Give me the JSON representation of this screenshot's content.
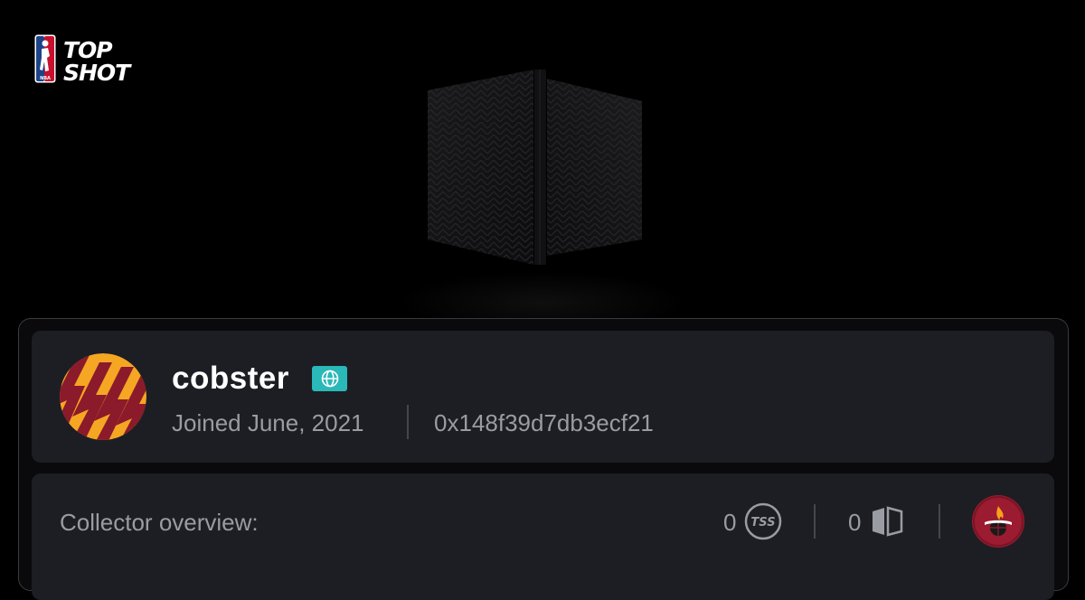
{
  "brand": {
    "logo_line1": "TOP",
    "logo_line2": "SHOT",
    "badge_text": "NBA"
  },
  "profile": {
    "username": "cobster",
    "joined": "Joined June, 2021",
    "address": "0x148f39d7db3ecf21",
    "badge_icon": "globe-icon",
    "avatar_colors": [
      "#f5a623",
      "#8b1a2b"
    ]
  },
  "overview": {
    "label": "Collector overview:",
    "stats": [
      {
        "value": "0",
        "icon": "tss-icon"
      },
      {
        "value": "0",
        "icon": "pack-icon"
      }
    ],
    "team_icon": "miami-heat-logo-icon"
  },
  "colors": {
    "accent": "#2ab8b8",
    "panel": "#1d1e23",
    "muted_text": "#9a9ca3"
  }
}
